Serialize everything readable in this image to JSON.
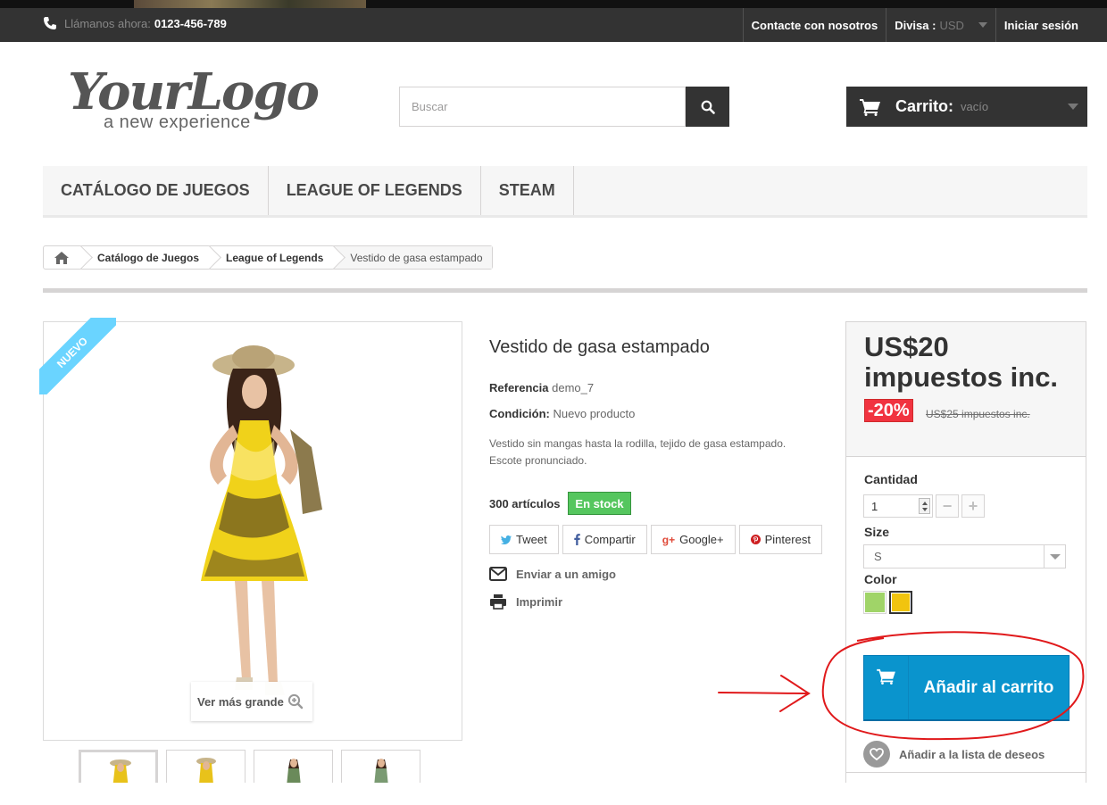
{
  "topbar": {
    "phone_label": "Llámanos ahora:",
    "phone_number": "0123-456-789",
    "contact": "Contacte con nosotros",
    "currency_label": "Divisa :",
    "currency_value": "USD",
    "login": "Iniciar sesión"
  },
  "header": {
    "logo_script": "YourLogo",
    "logo_tagline": "a new experience",
    "search_placeholder": "Buscar",
    "cart_label": "Carrito:",
    "cart_value": "vacío"
  },
  "menu": [
    "CATÁLOGO DE JUEGOS",
    "LEAGUE OF LEGENDS",
    "STEAM"
  ],
  "breadcrumb": [
    "Catálogo de Juegos",
    "League of Legends",
    "Vestido de gasa estampado"
  ],
  "product": {
    "badge": "Nuevo",
    "zoom_label": "Ver más grande",
    "title": "Vestido de gasa estampado",
    "ref_label": "Referencia",
    "ref_value": "demo_7",
    "cond_label": "Condición:",
    "cond_value": "Nuevo producto",
    "description": "Vestido sin mangas hasta la rodilla, tejido de gasa estampado. Escote pronunciado.",
    "quantity_text": "300 artículos",
    "stock_status": "En stock",
    "share": [
      "Tweet",
      "Compartir",
      "Google+",
      "Pinterest"
    ],
    "send_friend": "Enviar a un amigo",
    "print": "Imprimir"
  },
  "buybox": {
    "price": "US$20 impuestos inc.",
    "discount": "-20%",
    "old_price": "US$25 impuestos inc.",
    "qty_label": "Cantidad",
    "qty_value": "1",
    "size_label": "Size",
    "size_value": "S",
    "color_label": "Color",
    "colors": [
      "#a0d468",
      "#f1c40f"
    ],
    "add_to_cart": "Añadir al carrito",
    "wishlist": "Añadir a la lista de deseos"
  },
  "colors": {
    "topbar_bg": "#333333",
    "accent_blue": "#0a94cd",
    "stock_green": "#55c65e",
    "discount_red": "#f13340",
    "annotation_red": "#e0191b"
  }
}
